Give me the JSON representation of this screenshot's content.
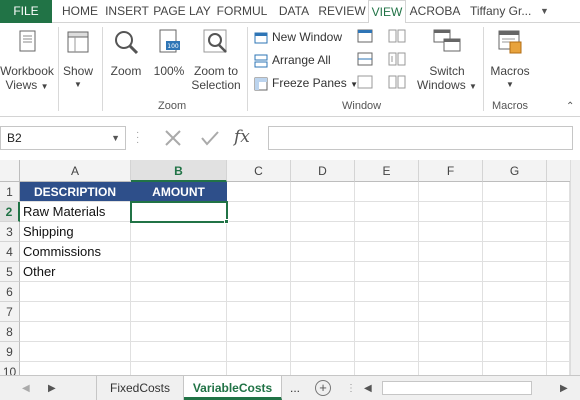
{
  "ribbon_tabs": [
    {
      "label": "FILE"
    },
    {
      "label": "HOME"
    },
    {
      "label": "INSERT"
    },
    {
      "label": "PAGE LAY"
    },
    {
      "label": "FORMUL"
    },
    {
      "label": "DATA"
    },
    {
      "label": "REVIEW"
    },
    {
      "label": "VIEW"
    },
    {
      "label": "ACROBA"
    }
  ],
  "user_name": "Tiffany Gr...",
  "ribbon": {
    "workbook_views": {
      "line1": "Workbook",
      "line2": "Views"
    },
    "show": "Show",
    "zoom": "Zoom",
    "zoom_100": "100%",
    "zoom_to_selection": {
      "line1": "Zoom to",
      "line2": "Selection"
    },
    "zoom_group": "Zoom",
    "new_window": "New Window",
    "arrange_all": "Arrange All",
    "freeze_panes": "Freeze Panes",
    "window_group": "Window",
    "switch_windows": {
      "line1": "Switch",
      "line2": "Windows"
    },
    "macros": "Macros",
    "macros_group": "Macros"
  },
  "formula_bar": {
    "name_box": "B2",
    "fx_label": "fx",
    "formula": ""
  },
  "columns": [
    "A",
    "B",
    "C",
    "D",
    "E",
    "F",
    "G"
  ],
  "rows": [
    "1",
    "2",
    "3",
    "4",
    "5",
    "6",
    "7",
    "8",
    "9",
    "10"
  ],
  "table": {
    "header": [
      "DESCRIPTION",
      "AMOUNT"
    ],
    "rows": [
      [
        "Raw Materials",
        ""
      ],
      [
        "Shipping",
        ""
      ],
      [
        "Commissions",
        ""
      ],
      [
        "Other",
        ""
      ]
    ]
  },
  "selected_cell": "B2",
  "sheets": [
    {
      "label": "FixedCosts"
    },
    {
      "label": "VariableCosts"
    }
  ],
  "sheets_more": "...",
  "colors": {
    "excel_green": "#217346",
    "header_fill": "#2e4f8a"
  }
}
